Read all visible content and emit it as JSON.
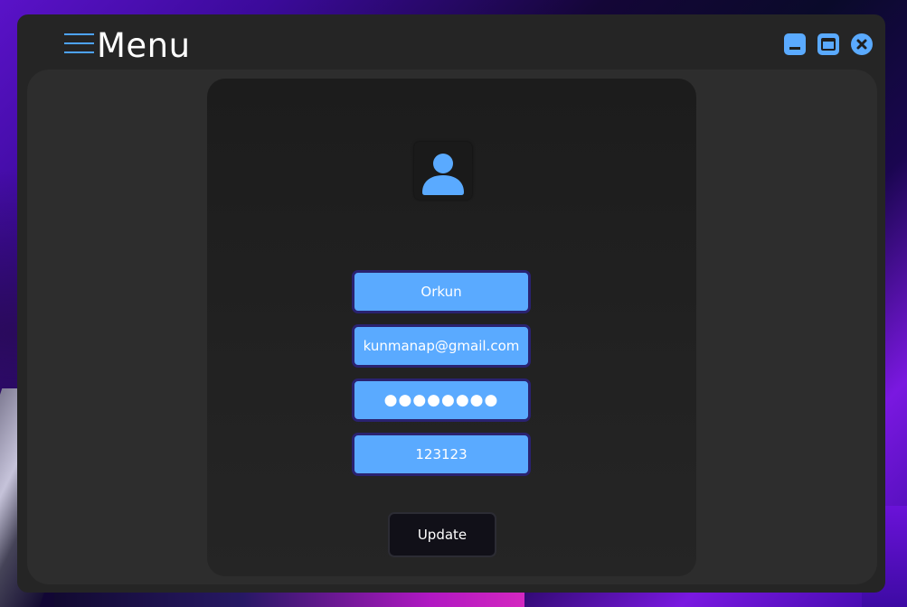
{
  "window": {
    "title": "Menu"
  },
  "profile": {
    "name": "Orkun",
    "email": "kunmanap@gmail.com",
    "password_mask": "●●●●●●●●",
    "code": "123123"
  },
  "actions": {
    "update_label": "Update"
  },
  "icons": {
    "menu": "hamburger-icon",
    "minimize": "minimize-icon",
    "maximize": "maximize-icon",
    "close": "close-icon",
    "avatar": "user-icon"
  },
  "colors": {
    "accent": "#5aaaff",
    "window_bg": "#252525",
    "content_bg": "#2d2d2d",
    "field_border": "#2a2270",
    "button_bg": "#111018"
  }
}
